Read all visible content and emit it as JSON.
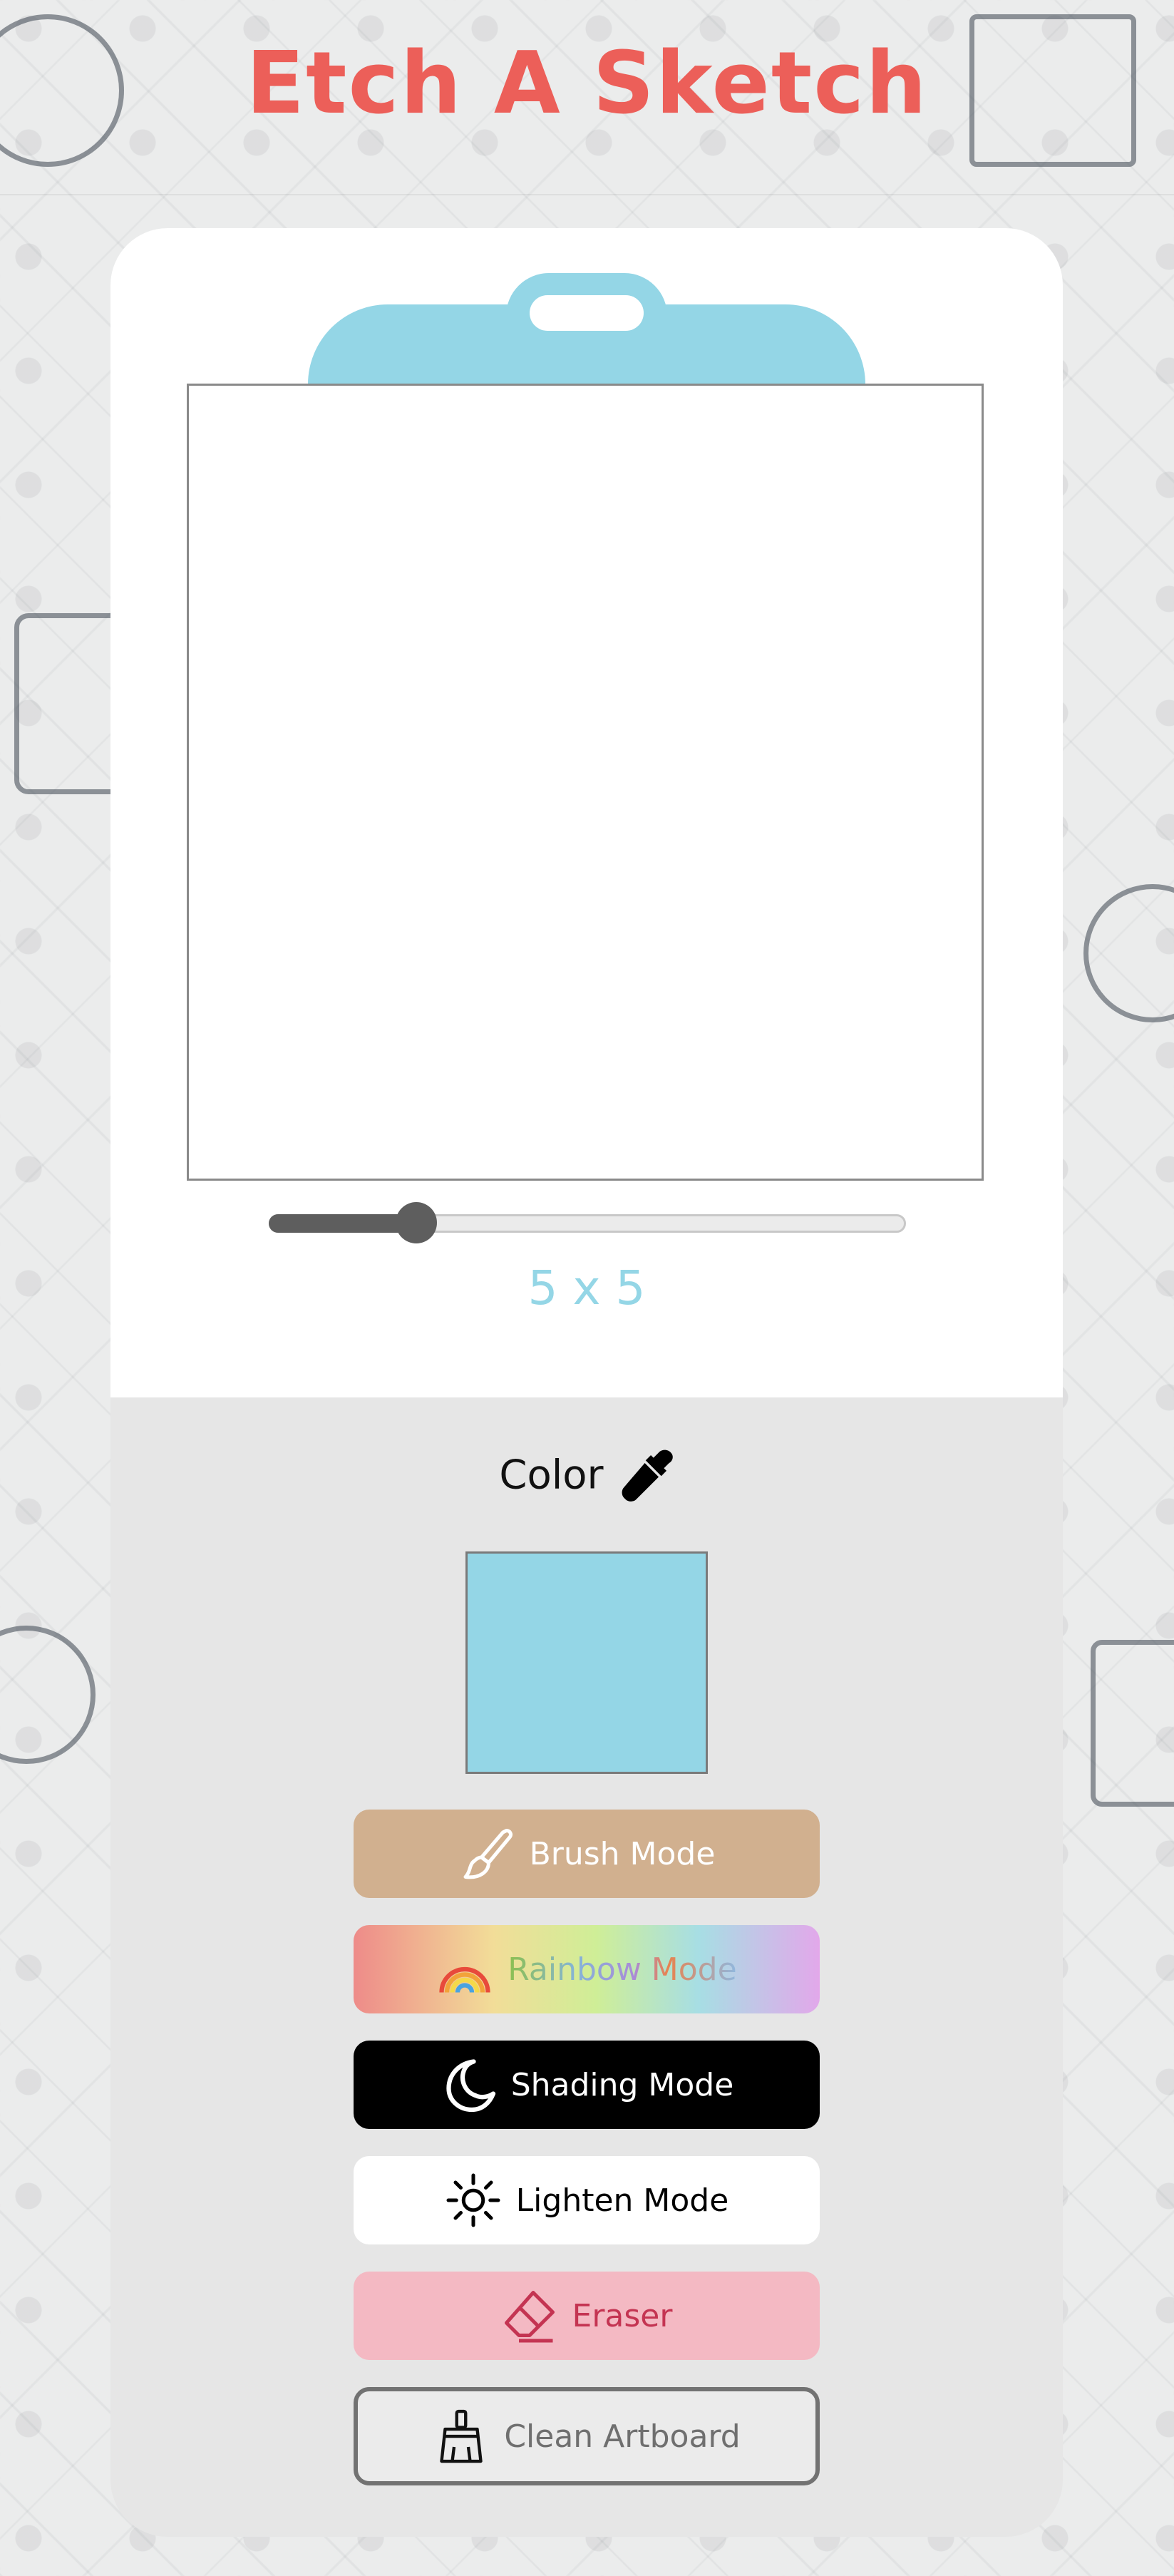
{
  "header": {
    "title": "Etch A Sketch"
  },
  "board": {
    "grid_size_label": "5 x 5",
    "grid_size_value": 5,
    "slider_level": 0.23
  },
  "color": {
    "label": "Color",
    "icon": "eyedropper-icon",
    "current_color": "#94d6e6"
  },
  "buttons": {
    "brush": {
      "label": "Brush Mode",
      "icon": "paintbrush-icon",
      "color": "#d1b08f"
    },
    "rainbow": {
      "label": "Rainbow Mode",
      "icon": "rainbow-icon"
    },
    "shading": {
      "label": "Shading Mode",
      "icon": "moon-icon",
      "color": "#000000"
    },
    "lighten": {
      "label": "Lighten Mode",
      "icon": "sun-icon",
      "color": "#ffffff"
    },
    "eraser": {
      "label": "Eraser",
      "icon": "eraser-icon",
      "color": "#f4b9c3"
    },
    "clean": {
      "label": "Clean Artboard",
      "icon": "broom-icon"
    }
  },
  "colors": {
    "title": "#ec5f59",
    "accent": "#94d6e6",
    "panel": "#e6e6e6"
  }
}
